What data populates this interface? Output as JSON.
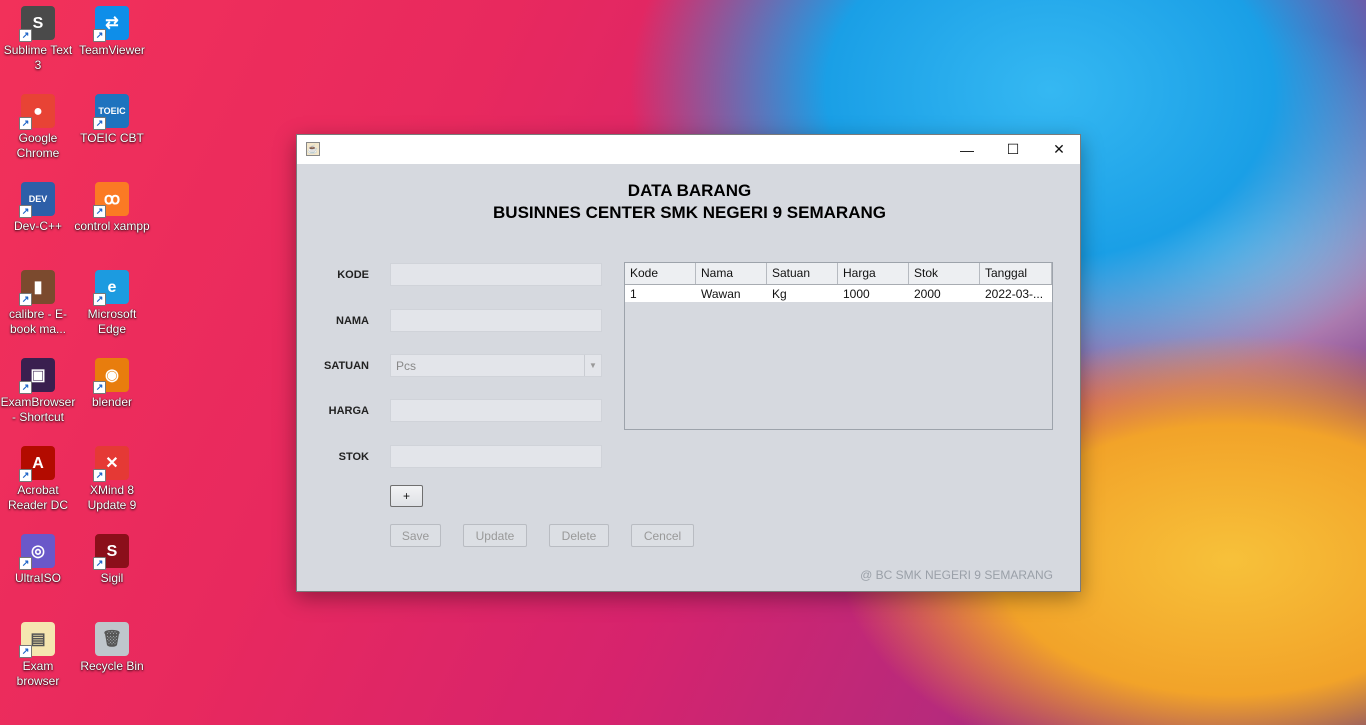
{
  "desktop": {
    "icons": [
      {
        "label": "Sublime Text 3",
        "icon": "sublime-text-icon",
        "color": "#4a4a4a",
        "glyph": "S"
      },
      {
        "label": "TeamViewer",
        "icon": "teamviewer-icon",
        "color": "#0e8ee9",
        "glyph": "⇄"
      },
      {
        "label": "Google Chrome",
        "icon": "chrome-icon",
        "color": "#e84335",
        "glyph": "●"
      },
      {
        "label": "TOEIC CBT",
        "icon": "toeic-icon",
        "color": "#1e73be",
        "glyph": "TOEIC"
      },
      {
        "label": "Dev-C++",
        "icon": "devcpp-icon",
        "color": "#2d5fa8",
        "glyph": "DEV"
      },
      {
        "label": "control xampp",
        "icon": "xampp-icon",
        "color": "#fb7a24",
        "glyph": "ꝏ"
      },
      {
        "label": "calibre - E-book ma...",
        "icon": "calibre-icon",
        "color": "#7b4a2e",
        "glyph": "▮"
      },
      {
        "label": "Microsoft Edge",
        "icon": "edge-icon",
        "color": "#1c9be0",
        "glyph": "e"
      },
      {
        "label": "ExamBrowser - Shortcut",
        "icon": "exambrowser-icon",
        "color": "#3a1f4f",
        "glyph": "▣"
      },
      {
        "label": "blender",
        "icon": "blender-icon",
        "color": "#e87d0d",
        "glyph": "◉"
      },
      {
        "label": "Acrobat Reader DC",
        "icon": "acrobat-icon",
        "color": "#b30b00",
        "glyph": "A"
      },
      {
        "label": "XMind 8 Update 9",
        "icon": "xmind-icon",
        "color": "#e53935",
        "glyph": "✕"
      },
      {
        "label": "UltraISO",
        "icon": "ultraiso-icon",
        "color": "#6a58c9",
        "glyph": "◎"
      },
      {
        "label": "Sigil",
        "icon": "sigil-icon",
        "color": "#8b0f1a",
        "glyph": "S"
      },
      {
        "label": "Exam browser",
        "icon": "exam-file-icon",
        "color": "#f5e6b0",
        "glyph": "▤"
      },
      {
        "label": "Recycle Bin",
        "icon": "recycle-bin-icon",
        "color": "#bfc6cc",
        "glyph": "🗑"
      }
    ]
  },
  "window": {
    "title_line1": "DATA BARANG",
    "title_line2": "BUSINNES CENTER SMK NEGERI 9 SEMARANG",
    "minimize": "—",
    "maximize": "☐",
    "close": "✕",
    "form": {
      "kode_label": "KODE",
      "nama_label": "NAMA",
      "satuan_label": "SATUAN",
      "satuan_value": "Pcs",
      "harga_label": "HARGA",
      "stok_label": "STOK",
      "add_label": "+"
    },
    "buttons": {
      "save": "Save",
      "update": "Update",
      "delete": "Delete",
      "cancel": "Cencel"
    },
    "table": {
      "columns": [
        "Kode",
        "Nama",
        "Satuan",
        "Harga",
        "Stok",
        "Tanggal"
      ],
      "rows": [
        [
          "1",
          "Wawan",
          "Kg",
          "1000",
          "2000",
          "2022-03-..."
        ]
      ]
    },
    "footer": "@ BC SMK NEGERI 9 SEMARANG"
  }
}
